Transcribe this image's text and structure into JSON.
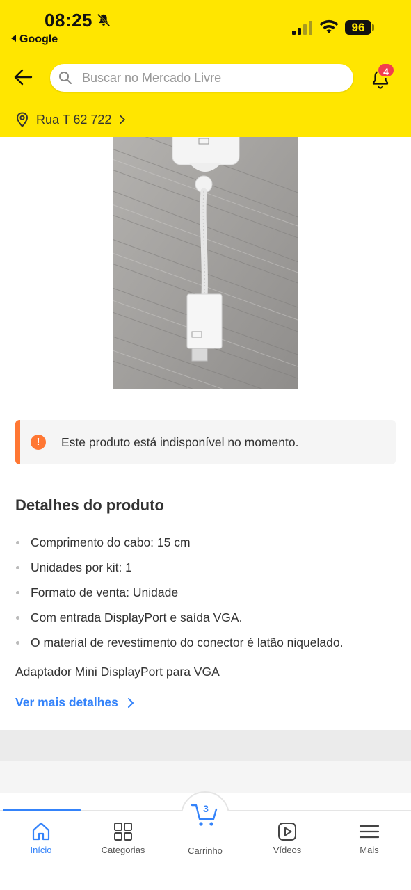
{
  "status_bar": {
    "time": "08:25",
    "back_app": "Google",
    "battery": "96"
  },
  "header": {
    "search_placeholder": "Buscar no Mercado Livre",
    "notifications_count": "4",
    "address": "Rua T 62 722"
  },
  "alert": {
    "text": "Este produto está indisponível no momento.",
    "icon": "!"
  },
  "details": {
    "title": "Detalhes do produto",
    "items": [
      "Comprimento do cabo: 15 cm",
      "Unidades por kit: 1",
      "Formato de venta: Unidade",
      "Com entrada DisplayPort e saída VGA.",
      "O material de revestimento do conector é latão niquelado."
    ],
    "description": "Adaptador Mini DisplayPort para VGA",
    "more_link": "Ver mais detalhes"
  },
  "bottom_nav": {
    "items": [
      {
        "label": "Início",
        "icon": "home-icon"
      },
      {
        "label": "Categorias",
        "icon": "grid-icon"
      },
      {
        "label": "Carrinho",
        "icon": "cart-icon"
      },
      {
        "label": "Vídeos",
        "icon": "play-icon"
      },
      {
        "label": "Mais",
        "icon": "menu-icon"
      }
    ],
    "cart_count": "3"
  },
  "colors": {
    "brand_yellow": "#ffe600",
    "accent_blue": "#3483fa",
    "warning_orange": "#ff7733",
    "badge_red": "#f23d4f"
  }
}
